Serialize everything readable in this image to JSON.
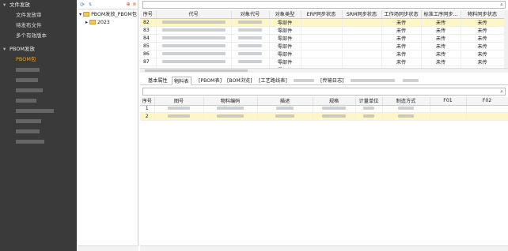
{
  "nav": {
    "sections": [
      {
        "label": "文件发放",
        "items": [
          {
            "label": "文件发放审"
          },
          {
            "label": "待发布文件"
          },
          {
            "label": "多个有效版本"
          }
        ]
      },
      {
        "label": "PBOM发放",
        "items": [
          {
            "label": "PBOM包",
            "active": true
          }
        ]
      }
    ]
  },
  "tree": {
    "root_label": "PBOM发放_PBOM包",
    "child_label": "2023"
  },
  "grid1": {
    "columns": [
      "序号",
      "代号",
      "对象代号",
      "对象类型",
      "ERP同步状态",
      "SRM同步状态",
      "工作场同步状态",
      "标准工序同步...",
      "物料同步状态"
    ],
    "rows": [
      {
        "no": "82",
        "type": "零部件",
        "ws": "未传",
        "std": "未传",
        "mat": "未传"
      },
      {
        "no": "83",
        "type": "零部件",
        "ws": "未传",
        "std": "未传",
        "mat": "未传"
      },
      {
        "no": "84",
        "type": "零部件",
        "ws": "未传",
        "std": "未传",
        "mat": "未传"
      },
      {
        "no": "85",
        "type": "零部件",
        "ws": "未传",
        "std": "未传",
        "mat": "未传"
      },
      {
        "no": "86",
        "type": "零部件",
        "ws": "未传",
        "std": "未传",
        "mat": "未传"
      },
      {
        "no": "87",
        "type": "零部件",
        "ws": "未传",
        "std": "未传",
        "mat": "未传"
      },
      {
        "no": "",
        "type": "零部件",
        "ws": "",
        "std": "",
        "mat": ""
      }
    ]
  },
  "tabs": [
    "基本属性",
    "物料表",
    "[PBOM表]",
    "[BOM浏览]",
    "[工艺路线表]",
    "",
    "[传输日志]",
    "",
    ""
  ],
  "grid2": {
    "columns": [
      "序号",
      "图号",
      "物料编码",
      "描述",
      "规格",
      "计量单位",
      "制造方式",
      "F01",
      "F02"
    ],
    "rows": [
      {
        "no": "1"
      },
      {
        "no": "2"
      }
    ]
  }
}
